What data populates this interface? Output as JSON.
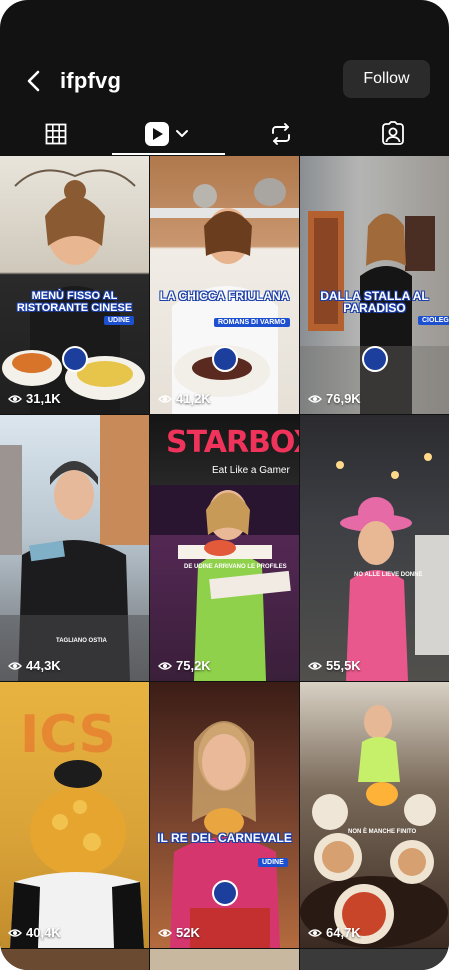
{
  "header": {
    "username": "ifpfvg",
    "follow_label": "Follow"
  },
  "tabs": [
    {
      "name": "grid-icon",
      "active": false
    },
    {
      "name": "play-icon",
      "active": true
    },
    {
      "name": "repost-icon",
      "active": false
    },
    {
      "name": "tagged-icon",
      "active": false
    }
  ],
  "videos": [
    {
      "views": "31,1K",
      "caption": "MENÙ FISSO AL RISTORANTE CINESE",
      "tag": "UDINE"
    },
    {
      "views": "41,2K",
      "caption": "LA CHICCA FRIULANA",
      "tag": "ROMANS DI VARMO"
    },
    {
      "views": "76,9K",
      "caption": "DALLA STALLA AL PARADISO",
      "tag": "CIOLEGAN"
    },
    {
      "views": "44,3K",
      "tag": "TAGLIANO OSTIA"
    },
    {
      "views": "75,2K",
      "sign": "STARBOX",
      "sign_sub": "Eat Like a Gamer",
      "tag": "DE UDINE ARRIVANO LE PROFILES"
    },
    {
      "views": "55,5K",
      "tag": "NO ALLE LIEVE DONNE"
    },
    {
      "views": "40,4K"
    },
    {
      "views": "52K",
      "caption": "IL RE DEL CARNEVALE",
      "tag": "UDINE"
    },
    {
      "views": "64,7K",
      "tag": "NON È MANCHE FINITO"
    }
  ],
  "colors": {
    "background": "#121212",
    "follow_bg": "#2b2b2b",
    "caption_outline": "#1b3ea8",
    "tag_blue": "#1d4fd1"
  }
}
